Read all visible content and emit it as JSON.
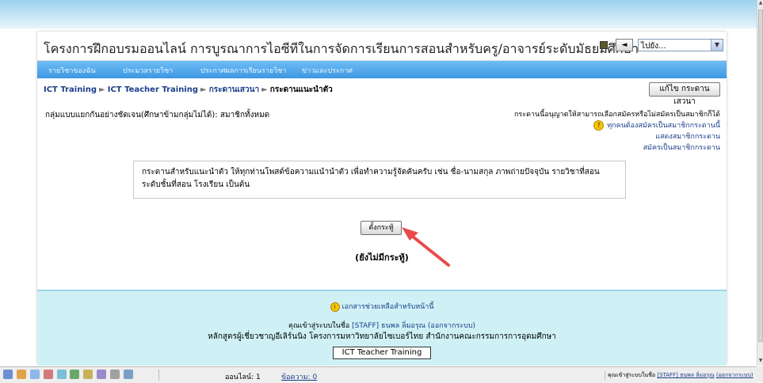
{
  "header": {
    "site_title": "โครงการฝึกอบรมออนไลน์ การบูรณาการไอซีทีในการจัดการเรียนการสอนสำหรับครู/อาจารย์ระดับมัธยมศึกษา",
    "jump_select": "ไปยัง...",
    "back_arrow": "◄"
  },
  "navbar": {
    "items": [
      "รายวิชาของฉัน",
      "ประมวลรายวิชา",
      "ประกาศผลการเรียนรายวิชา",
      "ข่าวและประกาศ"
    ]
  },
  "breadcrumb": {
    "items": [
      "ICT Training",
      "ICT Teacher Training",
      "กระดานเสวนา",
      "กระดานแนะนำตัว"
    ],
    "separator": "►"
  },
  "edit_button": "แก้ไข กระดานเสวนา",
  "group_mode": "กลุ่มแบบแยกกันอย่างชัดเจน(ศึกษาข้ามกลุ่มไม่ได้): สมาชิกทั้งหมด",
  "subscription": {
    "note": "กระดานนี้อนุญาตให้สามารถเลือกสมัครหรือไม่สมัครเป็นสมาชิกก็ได้",
    "help_glyph": "?",
    "links": [
      "ทุกคนต้องสมัครเป็นสมาชิกกระดานนี้",
      "แสดงสมาชิกกระดาน",
      "สมัครเป็นสมาชิกกระดาน"
    ]
  },
  "intro": {
    "line1": "กระดานสำหรับแนะนำตัว ให้ทุกท่านโพสต์ข้อความแนำนำตัว เพื่อทำความรู้จัดคันครับ เช่น ชื่อ-นามสกุล ภาพถ่ายปัจจุบัน รายวิชาที่สอน",
    "line2": "ระดับชั้นที่สอน โรงเรียน เป็นต้น"
  },
  "add_topic_button": "ตั้งกระทู้",
  "no_discussions": "(ยังไม่มีกระทู้)",
  "footer": {
    "help_glyph": "i",
    "help_link": "เอกสารช่วยเหลือสำหรับหน้านี้",
    "login_prefix": "คุณเข้าสู่ระบบในชื่อ",
    "login_user": "[STAFF] ธนพล ลิ่มอรุณ",
    "logout": "(ออกจากระบบ)",
    "org": "หลักสูตรผู้เชี่ยวชาญอีเลิร์นนิง โครงการมหาวิทยาลัยไซเบอร์ไทย สำนักงานคณะกรรมการการอุดมศึกษา",
    "course_button": "ICT Teacher Training"
  },
  "statusbar": {
    "online": "ออนไลน์: 1",
    "messages": "ข้อความ: 0",
    "login_prefix": "คุณเข้าสู่ระบบในชื่อ",
    "login_user": "[STAFF] ธนพล ลิ่มอรุณ",
    "logout": "(ออกจากระบบ)",
    "icons": [
      "users-icon",
      "profile-icon",
      "mail-icon",
      "calendar-icon",
      "chat-icon",
      "forum-icon",
      "tag-icon",
      "group-icon",
      "notes-icon",
      "search-icon"
    ]
  },
  "colors": {
    "navbar": "#3d98e2",
    "link": "#1a3d8a",
    "footer_bg": "#cff1f6",
    "arrow": "#e94b4b"
  }
}
